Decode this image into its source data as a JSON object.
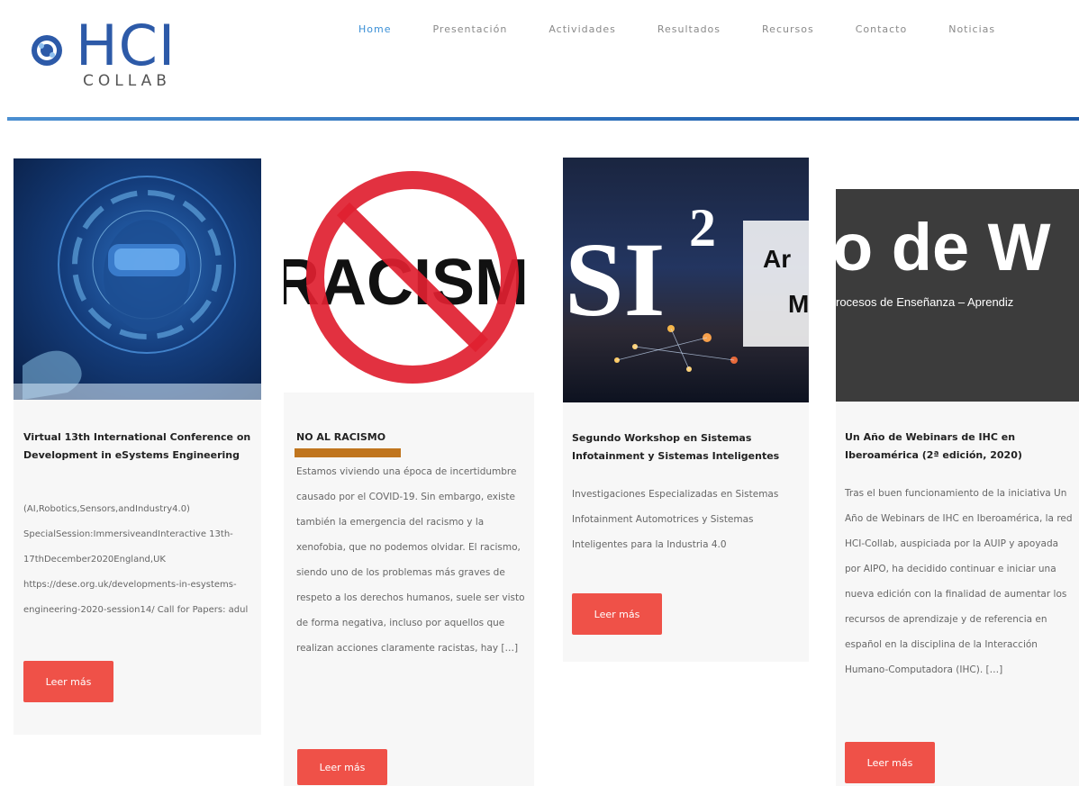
{
  "brand": {
    "name": "HCI",
    "sub": "COLLAB"
  },
  "nav": {
    "items": [
      {
        "label": "Home",
        "active": true
      },
      {
        "label": "Presentación",
        "active": false
      },
      {
        "label": "Actividades",
        "active": false
      },
      {
        "label": "Resultados",
        "active": false
      },
      {
        "label": "Recursos",
        "active": false
      },
      {
        "label": "Contacto",
        "active": false
      },
      {
        "label": "Noticias",
        "active": false
      }
    ]
  },
  "colors": {
    "accent": "#3a8fd6",
    "button": "#ef5148",
    "header_line": "#2a6cb8"
  },
  "posts": [
    {
      "title": "Virtual 13th International Conference on Development in eSystems Engineering",
      "excerpt": "(AI,Robotics,Sensors,andIndustry4.0) SpecialSession:ImmersiveandInteractive 13th-17thDecember2020England,UK https://dese.org.uk/developments-in-esystems-engineering-2020-session14/ Call for Papers: adul",
      "button": "Leer más"
    },
    {
      "title": "NO AL RACISMO",
      "image_text": "RACISM",
      "excerpt": "Estamos viviendo una época de incertidumbre causado por el COVID-19. Sin embargo, existe también la emergencia del racismo y la xenofobia, que no podemos olvidar.  El racismo, siendo uno de los problemas más graves de respeto a los derechos humanos, suele ser visto de forma negativa, incluso por aquellos que realizan acciones claramente racistas, hay […]",
      "button": "Leer más"
    },
    {
      "title": "Segundo Workshop en Sistemas Infotainment y Sistemas Inteligentes",
      "image_text": "SI",
      "image_sup": "2",
      "image_side": "Ar",
      "image_side2": "M",
      "excerpt": "Investigaciones Especializadas en Sistemas Infotainment Automotrices y Sistemas Inteligentes para la Industria 4.0",
      "button": "Leer más"
    },
    {
      "title": "Un Año de Webinars de IHC en Iberoamérica (2ª edición, 2020)",
      "image_text": "o de W",
      "image_sub": "rocesos de Enseñanza – Aprendiz",
      "excerpt": "Tras el buen funcionamiento de la iniciativa Un Año de Webinars de IHC en Iberoamérica, la red HCI-Collab, auspiciada por la AUIP y apoyada por AIPO, ha decidido continuar e iniciar una nueva edición con la finalidad de aumentar los recursos de aprendizaje y de referencia en español en la disciplina de la Interacción Humano-Computadora (IHC). […]",
      "button": "Leer más"
    }
  ]
}
